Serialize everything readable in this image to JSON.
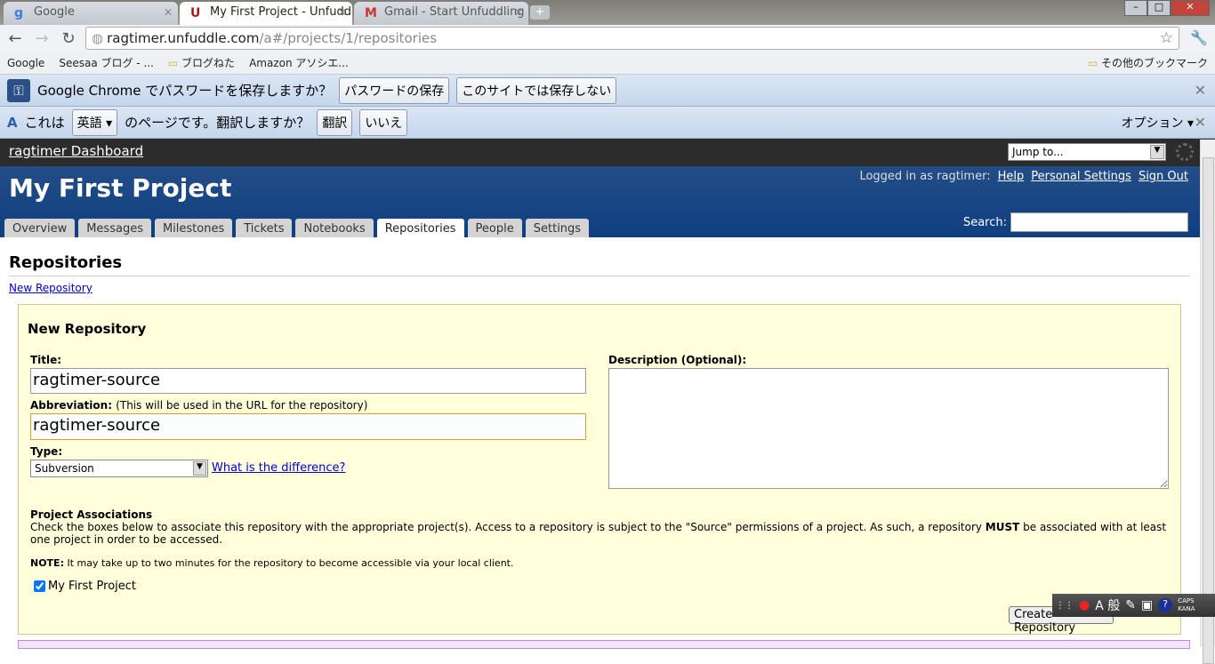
{
  "browser": {
    "tabs": [
      {
        "title": "Google",
        "icon": "google-icon"
      },
      {
        "title": "My First Project - Unfuddle",
        "icon": "unfuddle-icon"
      },
      {
        "title": "Gmail - Start Unfuddling",
        "icon": "gmail-icon"
      }
    ],
    "url_host": "ragtimer.unfuddle.com",
    "url_path": "/a#/projects/1/repositories",
    "bookmarks": [
      "Google",
      "Seesaa ブログ - ...",
      "ブログねた",
      "Amazon アソシエ..."
    ],
    "other_bookmarks": "その他のブックマーク",
    "password_bar": {
      "text": "Google Chrome でパスワードを保存しますか？",
      "save": "パスワードの保存",
      "never": "このサイトでは保存しない"
    },
    "translate_bar": {
      "prefix": "これは",
      "language": "英語",
      "suffix": "のページです。翻訳しますか？",
      "translate": "翻訳",
      "no": "いいえ",
      "options": "オプション"
    }
  },
  "app": {
    "dashboard_link": "ragtimer Dashboard",
    "jump_to": "Jump to...",
    "project_title": "My First Project",
    "logged_in": "Logged in as ragtimer:",
    "help": "Help",
    "personal_settings": "Personal Settings",
    "sign_out": "Sign Out",
    "search_label": "Search:",
    "tabs": [
      "Overview",
      "Messages",
      "Milestones",
      "Tickets",
      "Notebooks",
      "Repositories",
      "People",
      "Settings"
    ],
    "active_tab": "Repositories"
  },
  "page": {
    "heading": "Repositories",
    "new_repo_link": "New Repository",
    "form": {
      "heading": "New Repository",
      "title_label": "Title:",
      "title_value": "ragtimer-source",
      "abbr_label": "Abbreviation:",
      "abbr_hint": "(This will be used in the URL for the repository)",
      "abbr_value": "ragtimer-source",
      "type_label": "Type:",
      "type_value": "Subversion",
      "difference_link": "What is the difference?",
      "desc_label": "Description (Optional):",
      "assoc_heading": "Project Associations",
      "assoc_text_1": "Check the boxes below to associate this repository with the appropriate project(s). Access to a repository is subject to the \"Source\" permissions of a project. As such, a repository ",
      "assoc_must": "MUST",
      "assoc_text_2": " be associated with at least one project in order to be accessed.",
      "note_label": "NOTE:",
      "note_text": " It may take up to two minutes for the repository to become accessible via your local client.",
      "project_checkbox": "My First Project",
      "project_checked": true,
      "create_button": "Create Repository"
    }
  },
  "ime": {
    "mode": "A 般",
    "caps": "CAPS",
    "kana": "KANA"
  }
}
